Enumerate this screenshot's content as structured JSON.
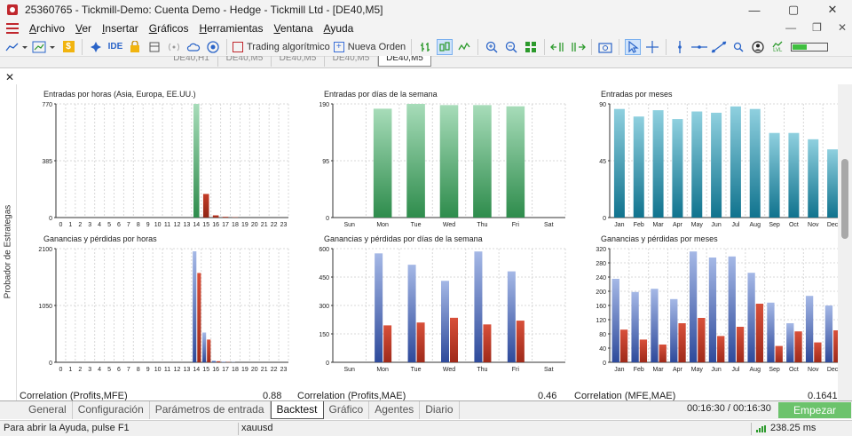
{
  "window": {
    "title": "25360765 - Tickmill-Demo: Cuenta Demo - Hedge - Tickmill Ltd - [DE40,M5]",
    "controls": [
      "—",
      "▢",
      "✕"
    ]
  },
  "menu": {
    "items": [
      {
        "label": "Archivo",
        "u": "A",
        "rest": "rchivo"
      },
      {
        "label": "Ver",
        "u": "V",
        "rest": "er"
      },
      {
        "label": "Insertar",
        "u": "I",
        "rest": "nsertar"
      },
      {
        "label": "Gráficos",
        "u": "G",
        "rest": "ráficos"
      },
      {
        "label": "Herramientas",
        "u": "H",
        "rest": "erramientas"
      },
      {
        "label": "Ventana",
        "u": "V",
        "rest": "entana"
      },
      {
        "label": "Ayuda",
        "u": "A",
        "rest": "yuda"
      }
    ],
    "right": [
      "—",
      "❐",
      "✕"
    ]
  },
  "toolbar": {
    "ide": "IDE",
    "algo_trading": "Trading algorítmico",
    "new_order": "Nueva Orden",
    "dollar": "$",
    "level": "LVL"
  },
  "chart_tabs": [
    "DE40,H1",
    "DE40,M5",
    "DE40,M5",
    "DE40,M5",
    "DE40,M5"
  ],
  "panel": {
    "close": "✕",
    "side_label": "Probador de Estrategas"
  },
  "chart_data": [
    {
      "type": "bar",
      "title": "Entradas por horas (Asia, Europa, EE.UU.)",
      "categories": [
        "0",
        "1",
        "2",
        "3",
        "4",
        "5",
        "6",
        "7",
        "8",
        "9",
        "10",
        "11",
        "12",
        "13",
        "14",
        "15",
        "16",
        "17",
        "18",
        "19",
        "20",
        "21",
        "22",
        "23"
      ],
      "series": [
        {
          "values": [
            0,
            0,
            0,
            0,
            0,
            0,
            0,
            0,
            0,
            0,
            0,
            0,
            0,
            0,
            770,
            160,
            15,
            5,
            2,
            0,
            0,
            0,
            0,
            0
          ]
        }
      ],
      "color_mode": "hours_green",
      "yticks": [
        0,
        385,
        770
      ],
      "ylim": [
        0,
        770
      ]
    },
    {
      "type": "bar",
      "title": "Entradas por días de la semana",
      "categories": [
        "Sun",
        "Mon",
        "Tue",
        "Wed",
        "Thu",
        "Fri",
        "Sat"
      ],
      "series": [
        {
          "values": [
            0,
            182,
            190,
            188,
            188,
            186,
            0
          ]
        }
      ],
      "color_mode": "green",
      "yticks": [
        0,
        95,
        190
      ],
      "ylim": [
        0,
        190
      ]
    },
    {
      "type": "bar",
      "title": "Entradas por meses",
      "categories": [
        "Jan",
        "Feb",
        "Mar",
        "Apr",
        "May",
        "Jun",
        "Jul",
        "Aug",
        "Sep",
        "Oct",
        "Nov",
        "Dec"
      ],
      "series": [
        {
          "values": [
            86,
            80,
            85,
            78,
            84,
            83,
            88,
            86,
            67,
            67,
            62,
            54
          ]
        }
      ],
      "color_mode": "teal",
      "yticks": [
        0,
        45,
        90
      ],
      "ylim": [
        0,
        90
      ]
    },
    {
      "type": "bar",
      "title": "Ganancias y pérdidas por horas",
      "categories": [
        "0",
        "1",
        "2",
        "3",
        "4",
        "5",
        "6",
        "7",
        "8",
        "9",
        "10",
        "11",
        "12",
        "13",
        "14",
        "15",
        "16",
        "17",
        "18",
        "19",
        "20",
        "21",
        "22",
        "23"
      ],
      "series": [
        {
          "values": [
            0,
            0,
            0,
            0,
            0,
            0,
            0,
            0,
            0,
            0,
            0,
            0,
            0,
            0,
            2050,
            550,
            30,
            10,
            5,
            0,
            0,
            0,
            0,
            0
          ]
        },
        {
          "values": [
            0,
            0,
            0,
            0,
            0,
            0,
            0,
            0,
            0,
            0,
            0,
            0,
            0,
            0,
            1650,
            420,
            20,
            5,
            0,
            0,
            0,
            0,
            0,
            0
          ]
        }
      ],
      "color_mode": "pl",
      "yticks": [
        0,
        1050,
        2100
      ],
      "ylim": [
        0,
        2100
      ]
    },
    {
      "type": "bar",
      "title": "Ganancias y pérdidas por días de la semana",
      "categories": [
        "Sun",
        "Mon",
        "Tue",
        "Wed",
        "Thu",
        "Fri",
        "Sat"
      ],
      "series": [
        {
          "values": [
            0,
            575,
            515,
            430,
            585,
            480,
            0
          ]
        },
        {
          "values": [
            0,
            195,
            210,
            235,
            200,
            220,
            0
          ]
        }
      ],
      "color_mode": "pl",
      "yticks": [
        0,
        150,
        300,
        450,
        600
      ],
      "ylim": [
        0,
        600
      ]
    },
    {
      "type": "bar",
      "title": "Ganancias y pérdidas por meses",
      "categories": [
        "Jan",
        "Feb",
        "Mar",
        "Apr",
        "May",
        "Jun",
        "Jul",
        "Aug",
        "Sep",
        "Oct",
        "Nov",
        "Dec"
      ],
      "series": [
        {
          "values": [
            235,
            198,
            207,
            178,
            312,
            295,
            298,
            252,
            168,
            110,
            187,
            160
          ]
        },
        {
          "values": [
            92,
            64,
            50,
            110,
            125,
            74,
            100,
            165,
            46,
            87,
            56,
            90
          ]
        }
      ],
      "color_mode": "pl",
      "yticks": [
        0,
        40,
        80,
        120,
        160,
        200,
        240,
        280,
        320
      ],
      "ylim": [
        0,
        320
      ]
    }
  ],
  "correlations": [
    {
      "label": "Correlation (Profits,MFE)",
      "value": "0.88"
    },
    {
      "label": "Correlation (Profits,MAE)",
      "value": "0.46"
    },
    {
      "label": "Correlation (MFE,MAE)",
      "value": "0.1641"
    }
  ],
  "bottom_tabs": [
    "General",
    "Configuración",
    "Parámetros de entrada",
    "Backtest",
    "Gráfico",
    "Agentes",
    "Diario"
  ],
  "active_bottom_tab": 3,
  "timer": "00:16:30 / 00:16:30",
  "start_button": "Empezar",
  "status": {
    "help": "Para abrir la Ayuda, pulse F1",
    "symbol": "xauusd",
    "ping": "238.25 ms"
  }
}
